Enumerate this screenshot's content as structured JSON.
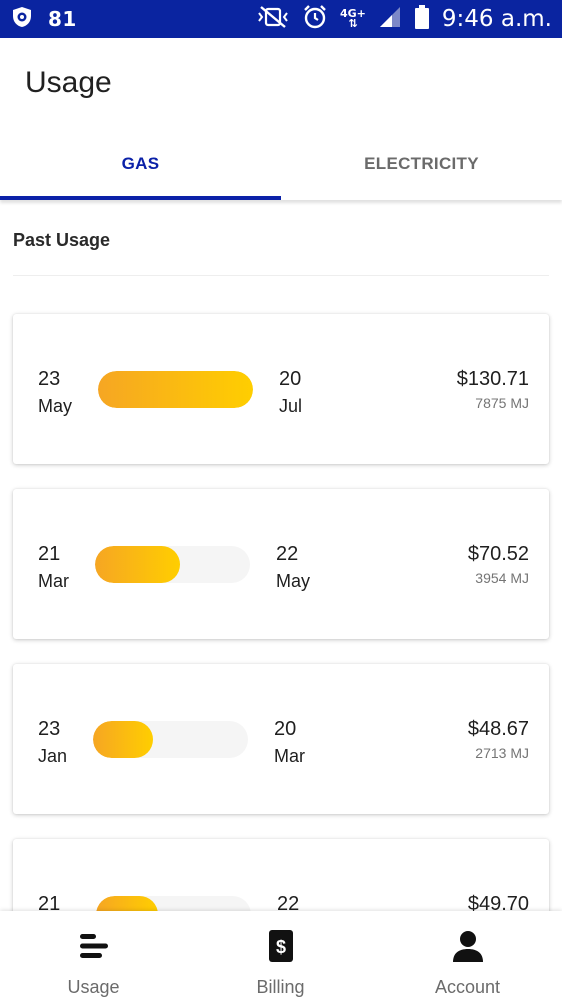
{
  "status_bar": {
    "notification_count": "81",
    "network_label": "4G+",
    "time": "9:46 a.m."
  },
  "header": {
    "title": "Usage"
  },
  "tabs": [
    {
      "label": "GAS",
      "active": true
    },
    {
      "label": "ELECTRICITY",
      "active": false
    }
  ],
  "section": {
    "title": "Past Usage"
  },
  "usage_items": [
    {
      "start_day": "23",
      "start_month": "May",
      "end_day": "20",
      "end_month": "Jul",
      "cost": "$130.71",
      "energy": "7875 MJ",
      "usage_fraction": 1.0
    },
    {
      "start_day": "21",
      "start_month": "Mar",
      "end_day": "22",
      "end_month": "May",
      "cost": "$70.52",
      "energy": "3954 MJ",
      "usage_fraction": 0.55
    },
    {
      "start_day": "23",
      "start_month": "Jan",
      "end_day": "20",
      "end_month": "Mar",
      "cost": "$48.67",
      "energy": "2713 MJ",
      "usage_fraction": 0.39
    },
    {
      "start_day": "21",
      "start_month": "",
      "end_day": "22",
      "end_month": "",
      "cost": "$49.70",
      "energy": "",
      "usage_fraction": 0.4
    }
  ],
  "bottom_nav": [
    {
      "label": "Usage",
      "icon": "usage-bars-icon"
    },
    {
      "label": "Billing",
      "icon": "dollar-bill-icon"
    },
    {
      "label": "Account",
      "icon": "person-icon"
    }
  ],
  "colors": {
    "status_bar": "#0a24a0",
    "accent": "#0b21a8",
    "bar_start": "#f6a623",
    "bar_end": "#ffce00"
  }
}
